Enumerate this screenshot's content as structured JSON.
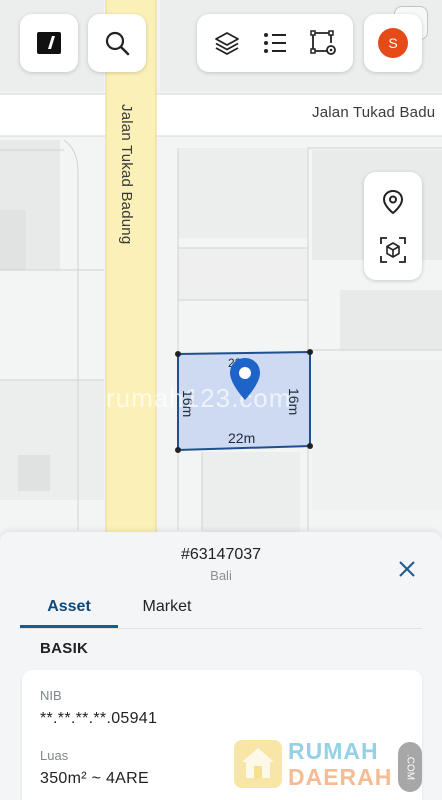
{
  "map": {
    "road_vertical_label": "Jalan Tukad Badung",
    "road_horizontal_label": "Jalan Tukad Badu",
    "parcel": {
      "width_label": "22m",
      "depth_label_left": "16m",
      "depth_label_right": "16m",
      "top_label": "22m"
    },
    "watermark": "rumah123.com"
  },
  "toolbar": {
    "avatar_initial": "S",
    "items": [
      "layers-icon",
      "list-icon",
      "polygon-settings-icon"
    ]
  },
  "side_tools": [
    "location-pin-icon",
    "3d-box-icon"
  ],
  "sheet": {
    "listing_id": "#63147037",
    "location": "Bali",
    "tabs": [
      {
        "label": "Asset",
        "active": true
      },
      {
        "label": "Market",
        "active": false
      }
    ],
    "section_title": "BASIK",
    "fields": [
      {
        "label": "NIB",
        "value": "**.**.**.**.05941"
      },
      {
        "label": "Luas",
        "value": "350m² ~ 4ARE"
      }
    ]
  },
  "brand": {
    "line1": "RUMAH",
    "line2": "DAERAH",
    "suffix": ".COM"
  },
  "colors": {
    "accent": "#0c4a7d",
    "road": "#fbf1b8",
    "parcel_fill": "#c9d7f2",
    "parcel_stroke": "#1f4f8f",
    "pin": "#1e63c7",
    "avatar": "#e64a19"
  }
}
